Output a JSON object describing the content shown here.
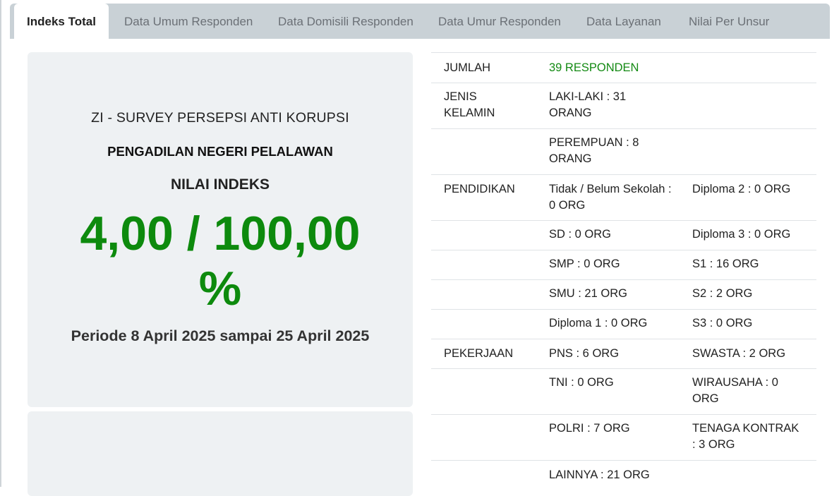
{
  "tabs": [
    {
      "label": "Indeks Total",
      "active": true
    },
    {
      "label": "Data Umum Responden",
      "active": false
    },
    {
      "label": "Data Domisili Responden",
      "active": false
    },
    {
      "label": "Data Umur Responden",
      "active": false
    },
    {
      "label": "Data Layanan",
      "active": false
    },
    {
      "label": "Nilai Per Unsur",
      "active": false
    }
  ],
  "summary": {
    "survey_title": "ZI - SURVEY PERSEPSI ANTI KORUPSI",
    "court_name": "PENGADILAN NEGERI PELALAWAN",
    "index_label": "NILAI INDEKS",
    "index_value": "4,00 / 100,00 %",
    "period": "Periode 8 April 2025 sampai 25 April 2025"
  },
  "respondents": {
    "total_label": "JUMLAH",
    "total_value": "39 RESPONDEN",
    "gender_label": "JENIS KELAMIN",
    "male": "LAKI-LAKI : 31 ORANG",
    "female": "PEREMPUAN : 8 ORANG",
    "education_label": "PENDIDIKAN",
    "education": [
      [
        "Tidak / Belum Sekolah : 0 ORG",
        "Diploma 2 : 0 ORG"
      ],
      [
        "SD : 0 ORG",
        "Diploma 3 : 0 ORG"
      ],
      [
        "SMP : 0 ORG",
        "S1 : 16 ORG"
      ],
      [
        "SMU : 21 ORG",
        "S2 : 2 ORG"
      ],
      [
        "Diploma 1 : 0 ORG",
        "S3 : 0 ORG"
      ]
    ],
    "job_label": "PEKERJAAN",
    "jobs": [
      [
        "PNS : 6 ORG",
        "SWASTA : 2 ORG"
      ],
      [
        "TNI : 0 ORG",
        "WIRAUSAHA : 0 ORG"
      ],
      [
        "POLRI : 7 ORG",
        "TENAGA KONTRAK : 3 ORG"
      ],
      [
        "LAINNYA : 21 ORG",
        ""
      ]
    ]
  },
  "colors": {
    "accent_green": "#0d8a0d",
    "tab_bar": "#c9d1d6",
    "panel_bg": "#eef1f3"
  }
}
